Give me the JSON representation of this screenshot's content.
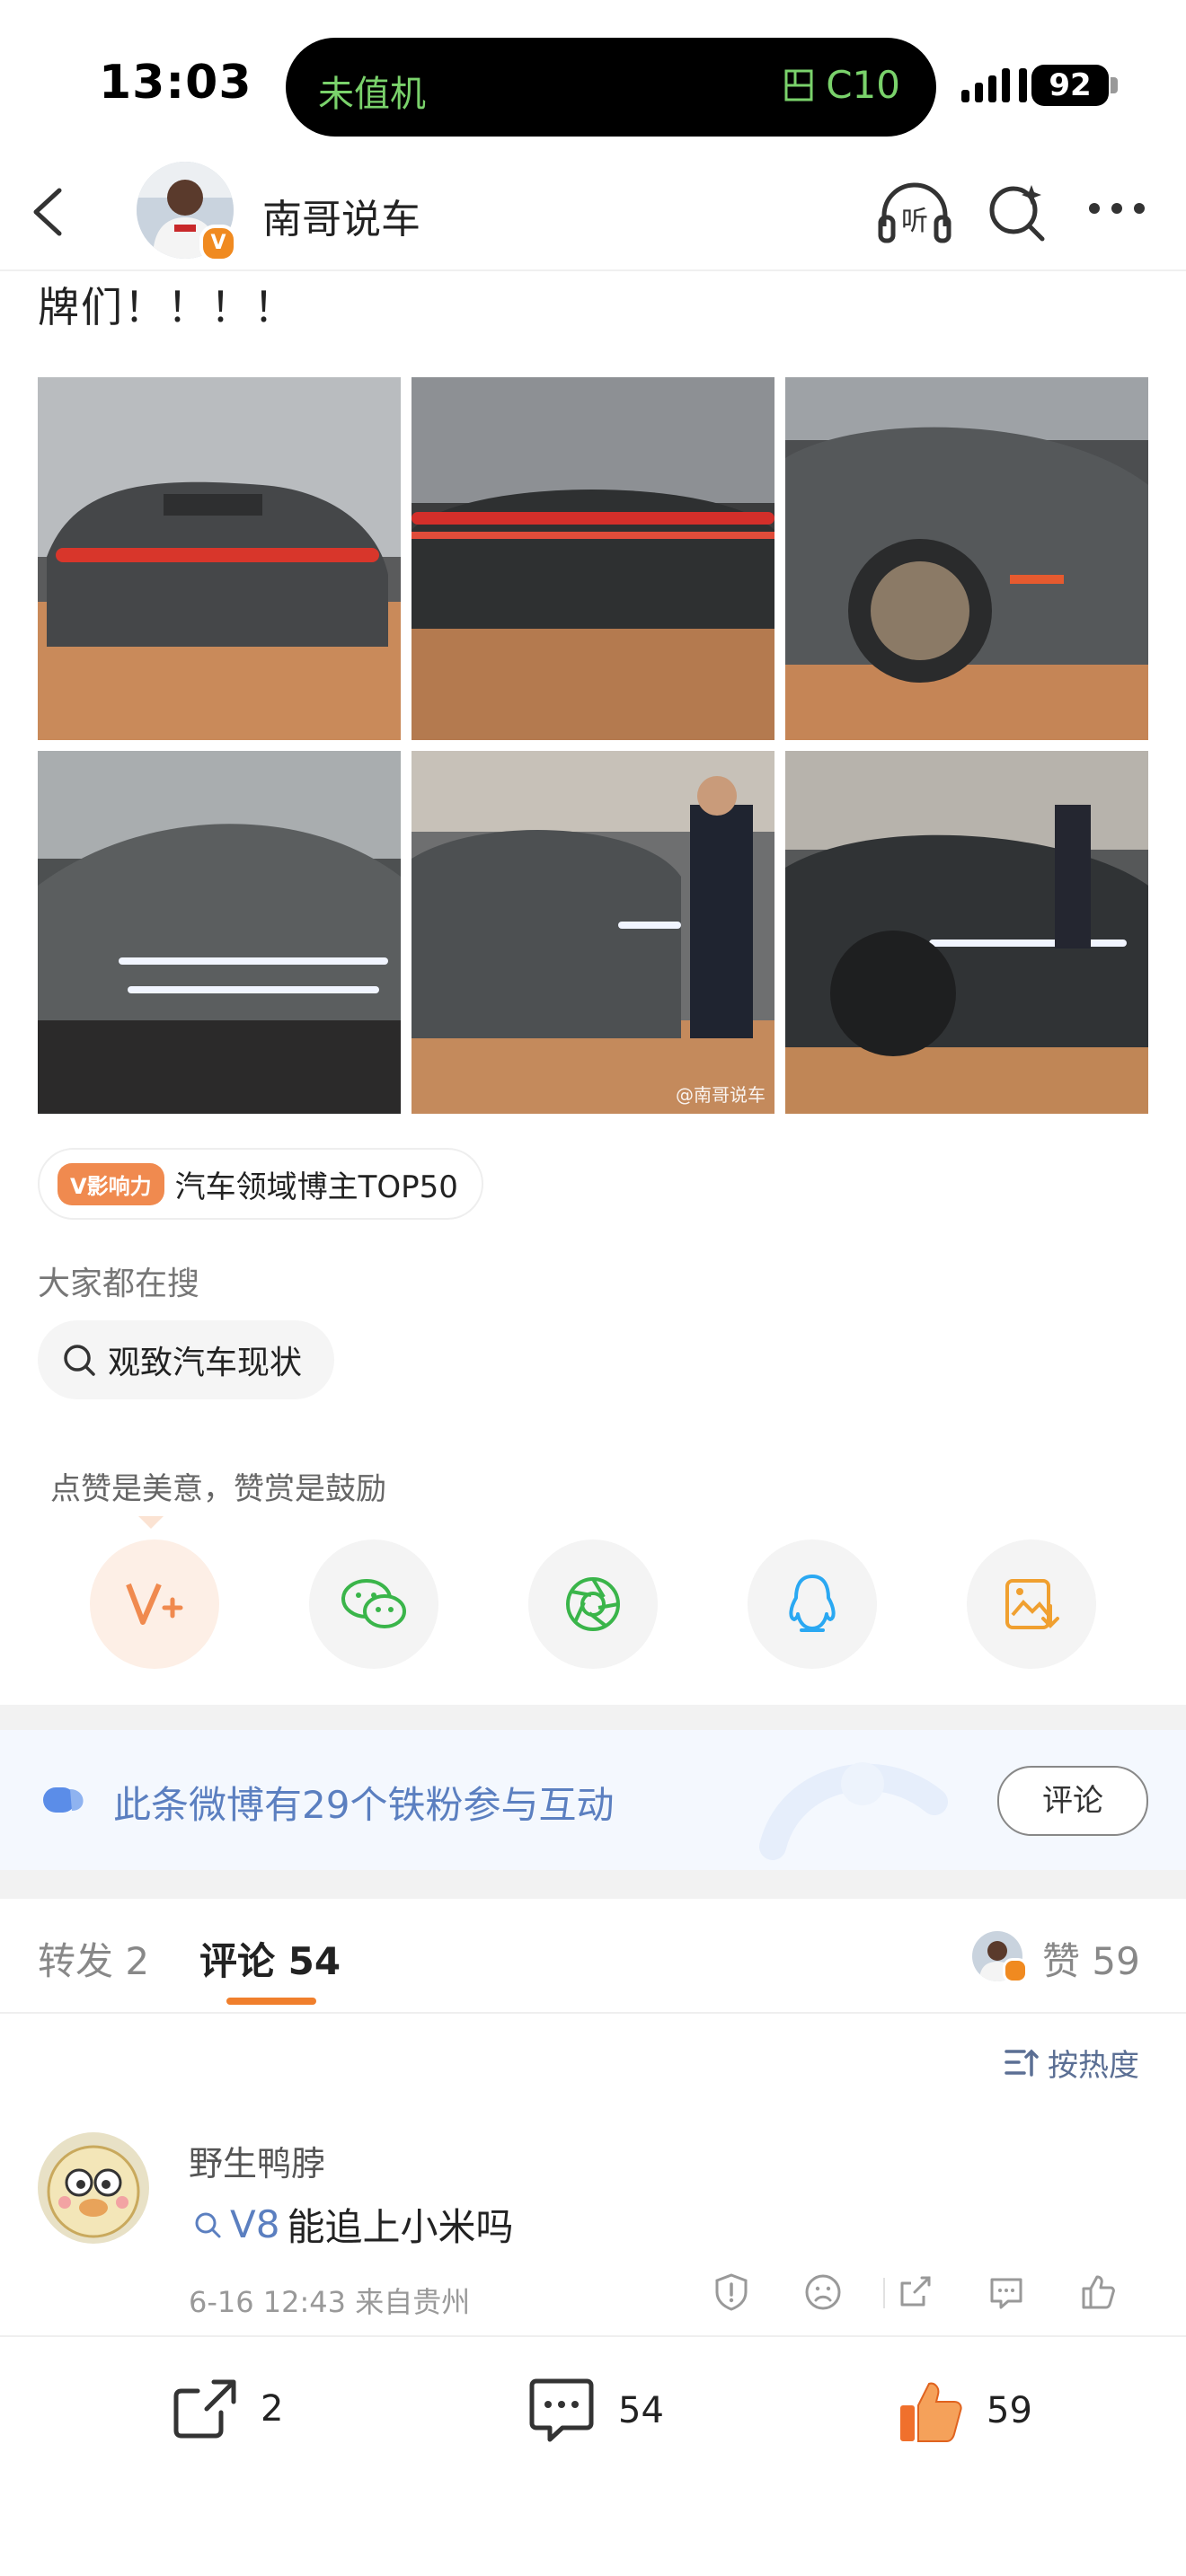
{
  "status_bar": {
    "time": "13:03",
    "carrier": "未值机",
    "flight": "C10",
    "battery": "92"
  },
  "header": {
    "author": "南哥说车",
    "badge": "V"
  },
  "post": {
    "text_tail": "牌们！！！！",
    "watermark": "@南哥说车",
    "tag_badge": "V影响力",
    "tag_text": "汽车领域博主TOP50"
  },
  "search": {
    "title": "大家都在搜",
    "chip": "观致汽车现状"
  },
  "reward": {
    "hint": "点赞是美意，赞赏是鼓励"
  },
  "fans": {
    "text": "此条微博有29个铁粉参与互动",
    "button": "评论"
  },
  "tabs": {
    "repost": "转发 2",
    "comments": "评论 54",
    "likes": "赞 59"
  },
  "sort": {
    "label": "按热度"
  },
  "comment": {
    "user": "野生鸭脖",
    "topic": "V8",
    "text": "能追上小米吗",
    "meta": "6-16 12:43  来自贵州"
  },
  "bottom_bar": {
    "reposts": "2",
    "comments": "54",
    "likes": "59"
  }
}
